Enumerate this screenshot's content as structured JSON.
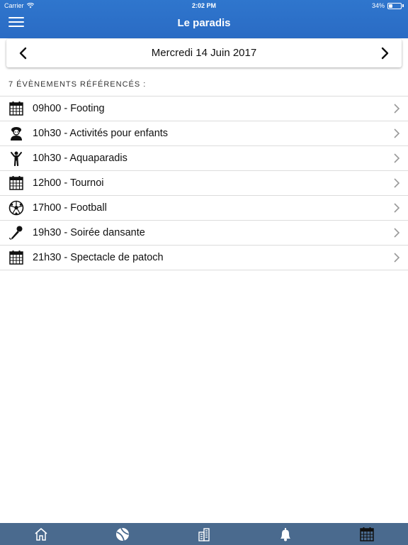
{
  "status_bar": {
    "carrier": "Carrier",
    "time": "2:02 PM",
    "battery": "34%",
    "battery_level": 0.34
  },
  "header": {
    "title": "Le paradis"
  },
  "date_nav": {
    "date": "Mercredi 14 Juin 2017"
  },
  "count_label": "7 ÉVÈNEMENTS RÉFÉRENCÉS :",
  "events": [
    {
      "title": "09h00 - Footing",
      "icon": "calendar-icon"
    },
    {
      "title": "10h30 - Activités pour enfants",
      "icon": "kids-icon"
    },
    {
      "title": "10h30 - Aquaparadis",
      "icon": "person-icon"
    },
    {
      "title": "12h00 - Tournoi",
      "icon": "calendar-icon"
    },
    {
      "title": "17h00 - Football",
      "icon": "soccer-ball-icon"
    },
    {
      "title": "19h30 - Soirée dansante",
      "icon": "microphone-icon"
    },
    {
      "title": "21h30 - Spectacle de patoch",
      "icon": "calendar-icon"
    }
  ],
  "tabs": [
    {
      "icon": "home-icon"
    },
    {
      "icon": "beach-ball-icon"
    },
    {
      "icon": "building-icon"
    },
    {
      "icon": "bell-icon"
    },
    {
      "icon": "calendar-icon"
    }
  ],
  "colors": {
    "header": "#2f76cd",
    "tab_bar": "#4a6a8e",
    "divider": "#dcdcdc"
  }
}
